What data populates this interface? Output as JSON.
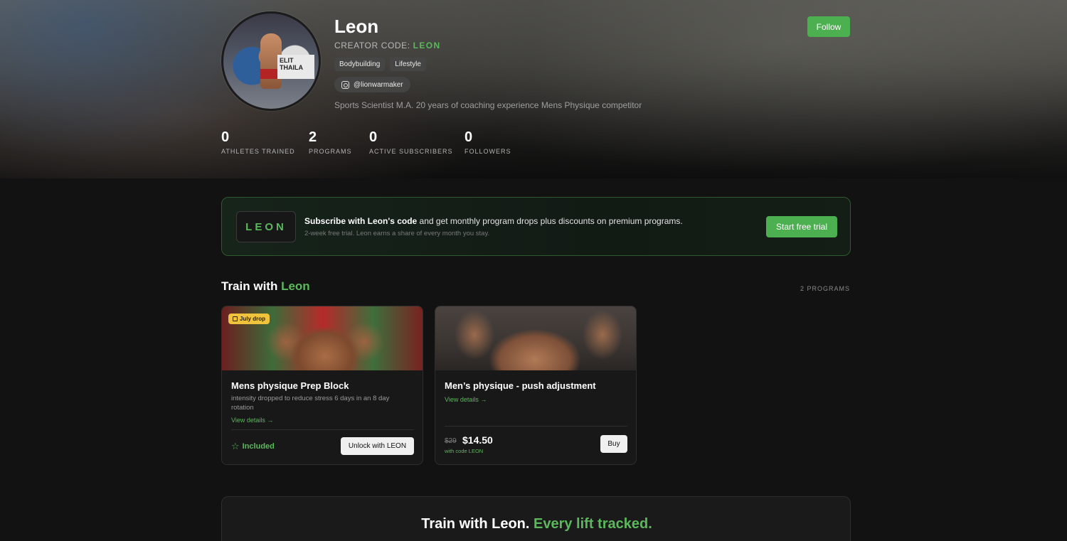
{
  "profile": {
    "name": "Leon",
    "creator_code_label": "CREATOR CODE:",
    "creator_code": "LEON",
    "tags": [
      "Bodybuilding",
      "Lifestyle"
    ],
    "instagram": "@lionwarmaker",
    "bio": "Sports Scientist M.A. 20 years of coaching experience Mens Physique competitor",
    "follow_label": "Follow",
    "avatar_sign_text": "ELIT THAILA"
  },
  "stats": [
    {
      "value": "0",
      "label": "ATHLETES TRAINED"
    },
    {
      "value": "2",
      "label": "PROGRAMS"
    },
    {
      "value": "0",
      "label": "ACTIVE SUBSCRIBERS"
    },
    {
      "value": "0",
      "label": "FOLLOWERS"
    }
  ],
  "promo": {
    "code": "LEON",
    "headline_bold": "Subscribe with Leon's code",
    "headline_rest": " and get monthly program drops plus discounts on premium programs.",
    "subtext": "2-week free trial. Leon earns a share of every month you stay.",
    "button_label": "Start free trial"
  },
  "programs_section": {
    "title_prefix": "Train with ",
    "title_accent": "Leon",
    "count_label": "2 PROGRAMS"
  },
  "programs": [
    {
      "badge": "July drop",
      "title": "Mens physique Prep Block",
      "description": "intensity dropped to reduce stress 6 days in an 8 day rotation",
      "view_label": "View details →",
      "included_label": "Included",
      "unlock_label": "Unlock with LEON"
    },
    {
      "title": "Men’s physique - push adjustment",
      "view_label": "View details →",
      "old_price": "$29",
      "new_price": "$14.50",
      "with_code": "with code LEON",
      "buy_label": "Buy"
    }
  ],
  "cta": {
    "title_main": "Train with Leon.",
    "title_accent": " Every lift tracked."
  },
  "colors": {
    "accent": "#4caf50",
    "accent_text": "#5cb85c",
    "badge": "#f0c33c",
    "background": "#121212"
  },
  "icons": {
    "instagram": "instagram-icon",
    "gift": "gift-icon",
    "star": "star-outline-icon"
  }
}
